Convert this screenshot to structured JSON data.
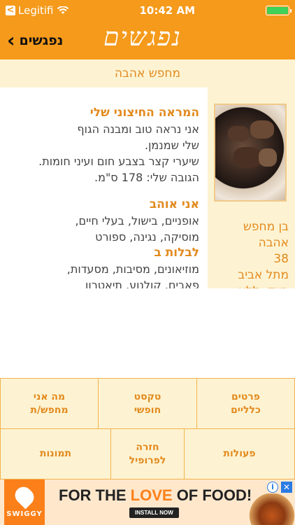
{
  "status": {
    "carrier": "Legitifi",
    "time": "10:42 AM",
    "back_glyph": "<"
  },
  "nav": {
    "back_label": "נפגשים",
    "back_icon": "chevron-left-icon",
    "logo": "נפגשים"
  },
  "page": {
    "subtitle": "מחפש אהבה"
  },
  "profile": {
    "side_lines": [
      "בן מחפש",
      "אהבה",
      "38",
      "מתל אביב",
      "רווק ,ללא"
    ],
    "appearance_heading": "המראה החיצוני שלי",
    "appearance_lines": [
      "אני נראה טוב ומבנה הגוף",
      "שלי שמנמן.",
      "שיערי קצר בצבע חום ועיני חומות.",
      "הגובה שלי: 178 ס\"מ."
    ],
    "love_heading": "אני אוהב",
    "love_lines": [
      "אופניים, בישול, בעלי חיים,",
      "מוסיקה, נגינה, ספורט"
    ],
    "spend_heading": "לבלות ב",
    "spend_lines": [
      "מוזיאונים, מסיבות, מסעדות,",
      "פאבים, קולנוע, תיאטרון"
    ]
  },
  "grid": {
    "row1": [
      "פרטים\nכלליים",
      "טקסט\nחופשי",
      "מה אני\nמחפש/ת"
    ],
    "row2": [
      "פעולות",
      "חזרה\nלפרופיל",
      "תמונות"
    ]
  },
  "ad": {
    "brand": "SWIGGY",
    "headline_a": "FOR THE ",
    "headline_b": "LOVE",
    "headline_c": " OF FOOD!",
    "cta": "INSTALL NOW",
    "info": "i",
    "close": "✕"
  },
  "colors": {
    "accent": "#f59a1b",
    "text_accent": "#e28a1e",
    "cream": "#fdf3d2"
  }
}
